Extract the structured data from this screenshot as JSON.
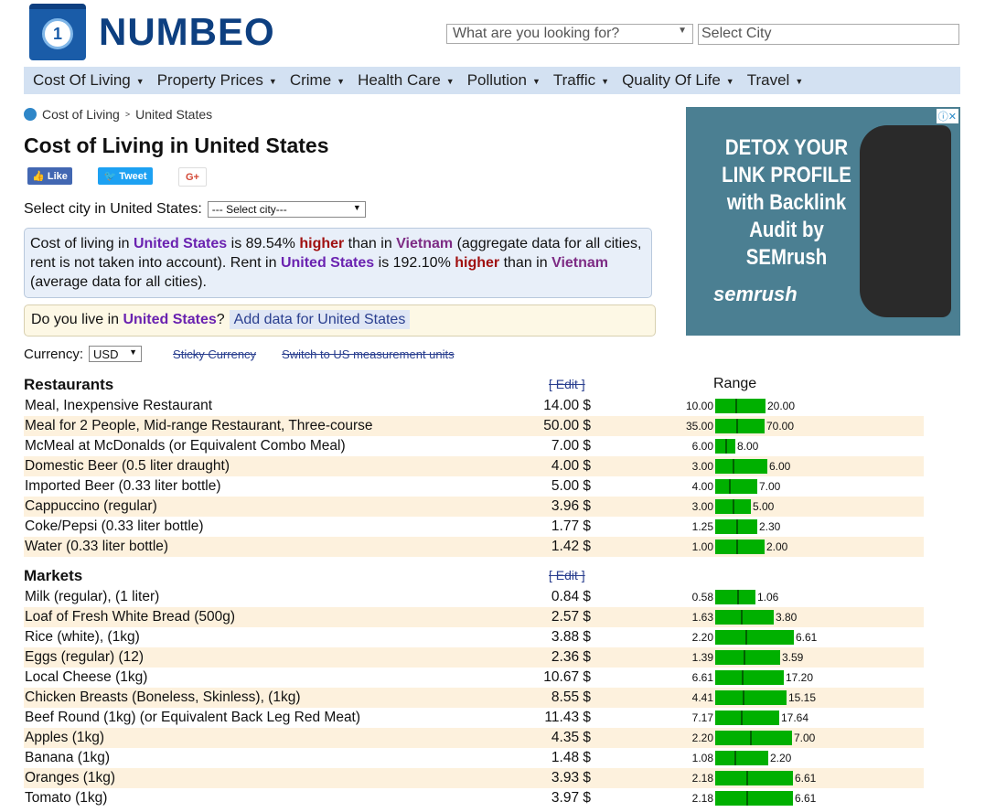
{
  "logo": {
    "text": "NUMBEO"
  },
  "search": {
    "placeholder": "What are you looking for?",
    "city_placeholder": "Select City"
  },
  "nav": [
    "Cost Of Living",
    "Property Prices",
    "Crime",
    "Health Care",
    "Pollution",
    "Traffic",
    "Quality Of Life",
    "Travel"
  ],
  "breadcrumb": [
    "Cost of Living",
    "United States"
  ],
  "title": "Cost of Living in United States",
  "social": {
    "like": "Like",
    "tweet": "Tweet",
    "gplus": "G+"
  },
  "select_city": {
    "label": "Select city in United States:",
    "value": "--- Select city---"
  },
  "summary": {
    "p1": "Cost of living in ",
    "country": "United States",
    "p2": " is 89.54% ",
    "higher": "higher",
    "p3": " than in ",
    "other": "Vietnam",
    "p4": " (aggregate data for all cities, rent is not taken into account). Rent in ",
    "p5": " is 192.10% ",
    "p6": " than in ",
    "p7": " (average data for all cities)."
  },
  "live": {
    "q1": "Do you live in ",
    "country": "United States",
    "q2": "?",
    "add": "Add data for United States"
  },
  "currency": {
    "label": "Currency:",
    "value": "USD",
    "sticky": "Sticky Currency",
    "switch": "Switch to US measurement units"
  },
  "range_header": "Range",
  "edit_label": "[ Edit ]",
  "sections": [
    {
      "title": "Restaurants",
      "rows": [
        [
          "Meal, Inexpensive Restaurant",
          "14.00 $",
          "10.00",
          "20.00",
          14,
          0.61
        ],
        [
          "Meal for 2 People, Mid-range Restaurant, Three-course",
          "50.00 $",
          "35.00",
          "70.00",
          50,
          0.6
        ],
        [
          "McMeal at McDonalds (or Equivalent Combo Meal)",
          "7.00 $",
          "6.00",
          "8.00",
          7,
          0.24
        ],
        [
          "Domestic Beer (0.5 liter draught)",
          "4.00 $",
          "3.00",
          "6.00",
          4,
          0.63
        ],
        [
          "Imported Beer (0.33 liter bottle)",
          "5.00 $",
          "4.00",
          "7.00",
          5,
          0.51
        ],
        [
          "Cappuccino (regular)",
          "3.96 $",
          "3.00",
          "5.00",
          3.96,
          0.43
        ],
        [
          "Coke/Pepsi (0.33 liter bottle)",
          "1.77 $",
          "1.25",
          "2.30",
          1.77,
          0.51
        ],
        [
          "Water (0.33 liter bottle)",
          "1.42 $",
          "1.00",
          "2.00",
          1.42,
          0.6
        ]
      ]
    },
    {
      "title": "Markets",
      "rows": [
        [
          "Milk (regular), (1 liter)",
          "0.84 $",
          "0.58",
          "1.06",
          0.84,
          0.49
        ],
        [
          "Loaf of Fresh White Bread (500g)",
          "2.57 $",
          "1.63",
          "3.80",
          2.57,
          0.71
        ],
        [
          "Rice (white), (1kg)",
          "3.88 $",
          "2.20",
          "6.61",
          3.88,
          0.96
        ],
        [
          "Eggs (regular) (12)",
          "2.36 $",
          "1.39",
          "3.59",
          2.36,
          0.79
        ],
        [
          "Local Cheese (1kg)",
          "10.67 $",
          "6.61",
          "17.20",
          10.67,
          0.83
        ],
        [
          "Chicken Breasts (Boneless, Skinless), (1kg)",
          "8.55 $",
          "4.41",
          "15.15",
          8.55,
          0.87
        ],
        [
          "Beef Round (1kg) (or Equivalent Back Leg Red Meat)",
          "11.43 $",
          "7.17",
          "17.64",
          11.43,
          0.78
        ],
        [
          "Apples (1kg)",
          "4.35 $",
          "2.20",
          "7.00",
          4.35,
          0.93
        ],
        [
          "Banana (1kg)",
          "1.48 $",
          "1.08",
          "2.20",
          1.48,
          0.64
        ],
        [
          "Oranges (1kg)",
          "3.93 $",
          "2.18",
          "6.61",
          3.93,
          0.94
        ],
        [
          "Tomato (1kg)",
          "3.97 $",
          "2.18",
          "6.61",
          3.97,
          0.94
        ]
      ]
    }
  ],
  "ad": {
    "headline": "DETOX YOUR LINK PROFILE with Backlink Audit by SEMrush",
    "brand": "semrush",
    "close": "ⓘ✕"
  }
}
